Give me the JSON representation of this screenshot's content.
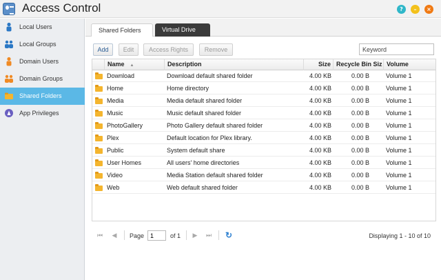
{
  "window": {
    "title": "Access Control",
    "buttons": {
      "help": "?",
      "minimize": "–",
      "close": "×"
    }
  },
  "sidebar": {
    "items": [
      {
        "label": "Local Users",
        "icon": "local-user-icon",
        "active": false
      },
      {
        "label": "Local Groups",
        "icon": "local-group-icon",
        "active": false
      },
      {
        "label": "Domain Users",
        "icon": "domain-user-icon",
        "active": false
      },
      {
        "label": "Domain Groups",
        "icon": "domain-group-icon",
        "active": false
      },
      {
        "label": "Shared Folders",
        "icon": "shared-folder-icon",
        "active": true
      },
      {
        "label": "App Privileges",
        "icon": "app-privileges-icon",
        "active": false
      }
    ]
  },
  "tabs": [
    {
      "label": "Shared Folders",
      "active": true
    },
    {
      "label": "Virtual Drive",
      "active": false
    }
  ],
  "toolbar": {
    "add": "Add",
    "edit": "Edit",
    "access_rights": "Access Rights",
    "remove": "Remove",
    "search_placeholder": "Keyword"
  },
  "table": {
    "columns": [
      "Name",
      "Description",
      "Size",
      "Recycle Bin Siz",
      "Volume"
    ],
    "sort_column": "Name",
    "rows": [
      {
        "name": "Download",
        "description": "Download default shared folder",
        "size": "4.00 KB",
        "recycle": "0.00 B",
        "volume": "Volume 1"
      },
      {
        "name": "Home",
        "description": "Home directory",
        "size": "4.00 KB",
        "recycle": "0.00 B",
        "volume": "Volume 1"
      },
      {
        "name": "Media",
        "description": "Media default shared folder",
        "size": "4.00 KB",
        "recycle": "0.00 B",
        "volume": "Volume 1"
      },
      {
        "name": "Music",
        "description": "Music default shared folder",
        "size": "4.00 KB",
        "recycle": "0.00 B",
        "volume": "Volume 1"
      },
      {
        "name": "PhotoGallery",
        "description": "Photo Gallery default shared folder",
        "size": "4.00 KB",
        "recycle": "0.00 B",
        "volume": "Volume 1"
      },
      {
        "name": "Plex",
        "description": "Default location for Plex library.",
        "size": "4.00 KB",
        "recycle": "0.00 B",
        "volume": "Volume 1"
      },
      {
        "name": "Public",
        "description": "System default share",
        "size": "4.00 KB",
        "recycle": "0.00 B",
        "volume": "Volume 1"
      },
      {
        "name": "User Homes",
        "description": "All users' home directories",
        "size": "4.00 KB",
        "recycle": "0.00 B",
        "volume": "Volume 1"
      },
      {
        "name": "Video",
        "description": "Media Station default shared folder",
        "size": "4.00 KB",
        "recycle": "0.00 B",
        "volume": "Volume 1"
      },
      {
        "name": "Web",
        "description": "Web default shared folder",
        "size": "4.00 KB",
        "recycle": "0.00 B",
        "volume": "Volume 1"
      }
    ]
  },
  "pager": {
    "page_label": "Page",
    "page_value": "1",
    "of_label": "of 1",
    "display_text": "Displaying 1 - 10 of 10"
  },
  "colors": {
    "sidebar_active": "#5bb8e6",
    "virtual_drive_tab": "#3a3a3a",
    "folder": "#f4b52e",
    "help_button": "#2fb7c9",
    "minimize_button": "#f3c11b",
    "close_button": "#f07a14"
  }
}
